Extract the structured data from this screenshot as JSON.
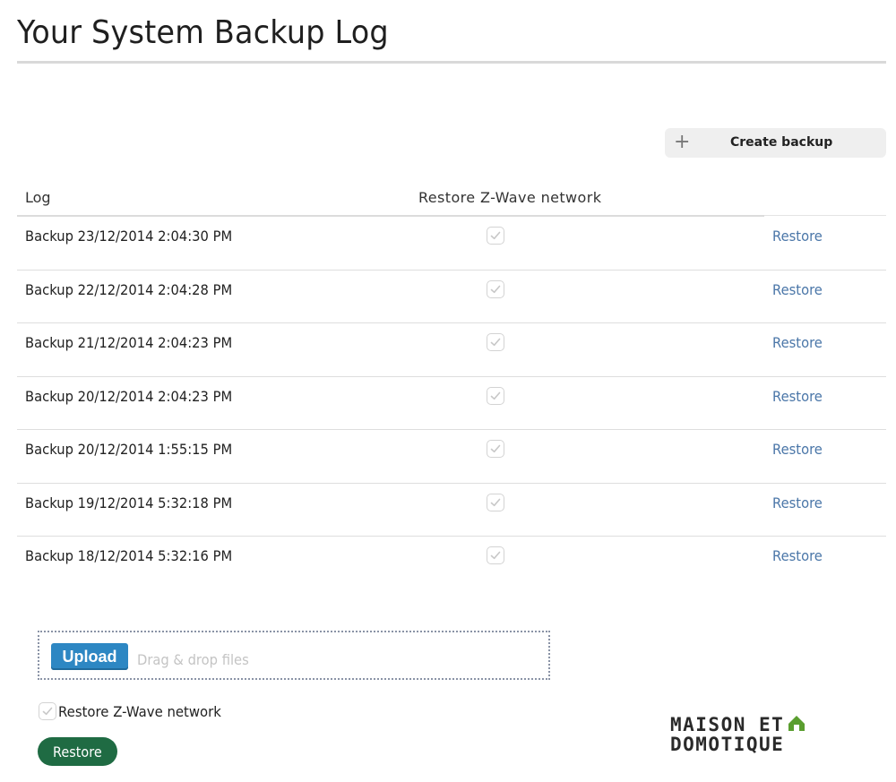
{
  "header": {
    "title": "Your System Backup Log"
  },
  "toolbar": {
    "create_label": "Create backup",
    "create_icon": "plus-icon"
  },
  "table": {
    "columns": {
      "log": "Log",
      "zwave": "Restore Z-Wave network"
    },
    "rows": [
      {
        "log": "Backup 23/12/2014 2:04:30 PM",
        "zwave_checked": true,
        "action": "Restore"
      },
      {
        "log": "Backup 22/12/2014 2:04:28 PM",
        "zwave_checked": true,
        "action": "Restore"
      },
      {
        "log": "Backup 21/12/2014 2:04:23 PM",
        "zwave_checked": true,
        "action": "Restore"
      },
      {
        "log": "Backup 20/12/2014 2:04:23 PM",
        "zwave_checked": true,
        "action": "Restore"
      },
      {
        "log": "Backup 20/12/2014 1:55:15 PM",
        "zwave_checked": true,
        "action": "Restore"
      },
      {
        "log": "Backup 19/12/2014 5:32:18 PM",
        "zwave_checked": true,
        "action": "Restore"
      },
      {
        "log": "Backup 18/12/2014 5:32:16 PM",
        "zwave_checked": true,
        "action": "Restore"
      }
    ]
  },
  "upload": {
    "button_label": "Upload",
    "hint": "Drag & drop files"
  },
  "restore_options": {
    "zwave_label": "Restore Z-Wave network",
    "zwave_checked": true,
    "button_label": "Restore"
  },
  "logo": {
    "line1": "MAISON ET",
    "line2": "DOMOTIQUE"
  },
  "colors": {
    "link": "#4a76a8",
    "upload": "#2d87c3",
    "restore": "#1f6b43",
    "logo_accent": "#5a9e2f"
  }
}
